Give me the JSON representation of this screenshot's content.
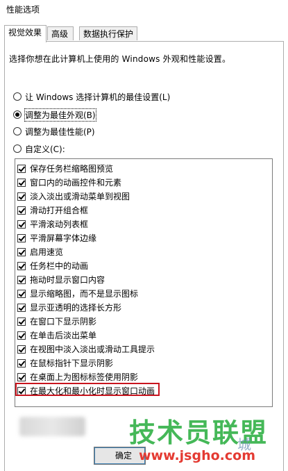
{
  "window": {
    "title": "性能选项"
  },
  "tabs": [
    {
      "label": "视觉效果",
      "active": true
    },
    {
      "label": "高级",
      "active": false
    },
    {
      "label": "数据执行保护",
      "active": false
    }
  ],
  "description": "选择你想在此计算机上使用的 Windows 外观和性能设置。",
  "radios": [
    {
      "label": "让 Windows 选择计算机的最佳设置(L)",
      "checked": false
    },
    {
      "label": "调整为最佳外观(B)",
      "checked": true
    },
    {
      "label": "调整为最佳性能(P)",
      "checked": false
    },
    {
      "label": "自定义(C):",
      "checked": false
    }
  ],
  "effects": [
    {
      "label": "保存任务栏缩略图预览",
      "checked": true
    },
    {
      "label": "窗口内的动画控件和元素",
      "checked": true
    },
    {
      "label": "淡入淡出或滑动菜单到视图",
      "checked": true
    },
    {
      "label": "滑动打开组合框",
      "checked": true
    },
    {
      "label": "平滑滚动列表框",
      "checked": true
    },
    {
      "label": "平滑屏幕字体边缘",
      "checked": true
    },
    {
      "label": "启用速览",
      "checked": true
    },
    {
      "label": "任务栏中的动画",
      "checked": true
    },
    {
      "label": "拖动时显示窗口内容",
      "checked": true
    },
    {
      "label": "显示缩略图，而不是显示图标",
      "checked": true
    },
    {
      "label": "显示亚透明的选择长方形",
      "checked": true
    },
    {
      "label": "在窗口下显示阴影",
      "checked": true
    },
    {
      "label": "在单击后淡出菜单",
      "checked": true
    },
    {
      "label": "在视图中淡入淡出或滑动工具提示",
      "checked": true
    },
    {
      "label": "在鼠标指针下显示阴影",
      "checked": true
    },
    {
      "label": "在桌面上为图标标签使用阴影",
      "checked": true
    },
    {
      "label": "在最大化和最小化时显示窗口动画",
      "checked": true
    }
  ],
  "buttons": {
    "ok": "确定"
  },
  "watermark": {
    "main": "技术员联盟",
    "url": "www.jsgho.com",
    "tail": "城"
  },
  "colors": {
    "highlight_border": "#c8141e",
    "watermark_green": "#36b24a",
    "watermark_red": "#e43a32"
  }
}
